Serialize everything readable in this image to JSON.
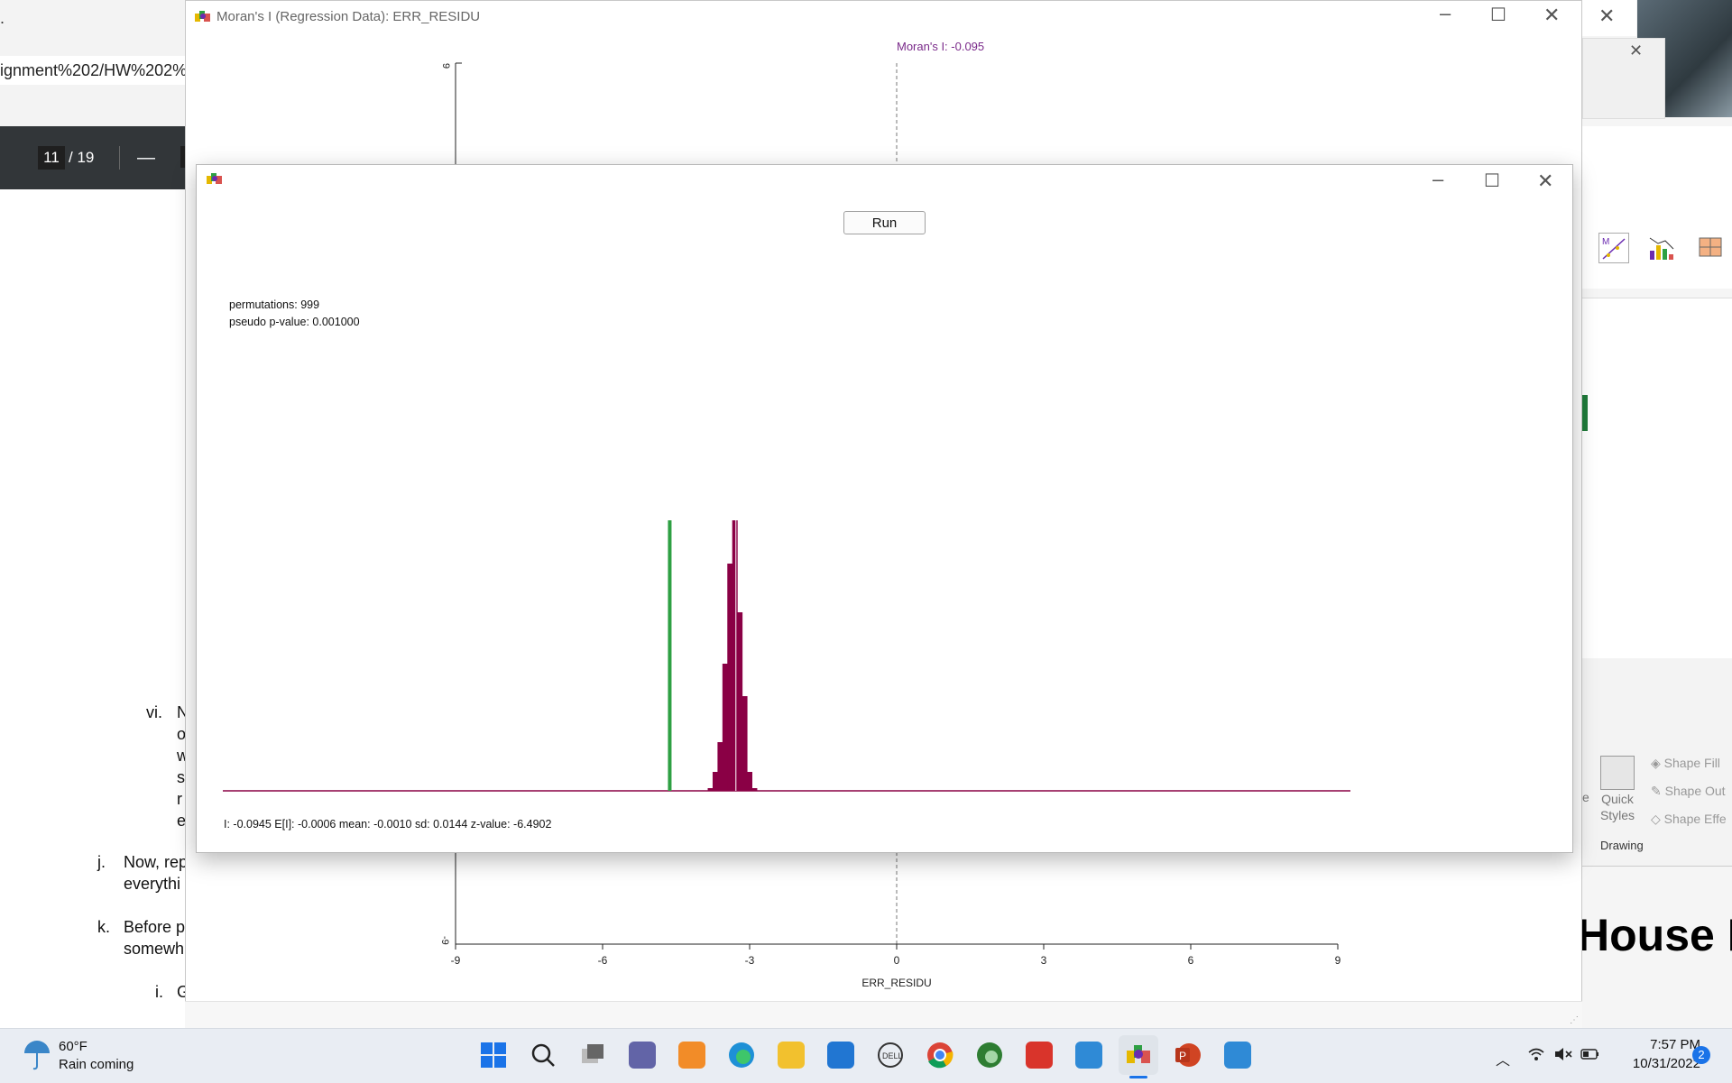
{
  "pdf": {
    "url_fragment": "ignment%202/HW%202%2",
    "page_current": "11",
    "page_total": "/ 19",
    "zoom_out": "—",
    "items": [
      {
        "marker": "vi.",
        "text": "N",
        "lines": [
          "o",
          "w",
          "s",
          "r",
          "e"
        ]
      },
      {
        "marker": "j.",
        "line1": "Now, rep",
        "line2": "everythi"
      },
      {
        "marker": "k.",
        "line1": "Before p",
        "line2": "somewh"
      },
      {
        "marker": "i.",
        "line1": "G"
      }
    ]
  },
  "main_window": {
    "title": "Moran's I (Regression Data): ERR_RESIDU",
    "moran_label": "Moran's I: -0.095",
    "x_axis_label": "ERR_RESIDU",
    "x_ticks": [
      "-9",
      "-6",
      "-3",
      "0",
      "3",
      "6",
      "9"
    ],
    "y_top": "9",
    "y_bottom": "-9"
  },
  "dialog": {
    "run_label": "Run",
    "permutations": "permutations: 999",
    "pvalue": "pseudo p-value: 0.001000",
    "stats": "I: -0.0945   E[I]: -0.0006   mean: -0.0010   sd: 0.0144    z-value: -6.4902"
  },
  "chart_data": {
    "type": "bar",
    "title": "",
    "observed_I": -0.0945,
    "observed_line_color": "#2ea043",
    "bar_color": "#8a0045",
    "bins": [
      {
        "pos": -3.8,
        "height": 0.01
      },
      {
        "pos": -3.7,
        "height": 0.07
      },
      {
        "pos": -3.6,
        "height": 0.18
      },
      {
        "pos": -3.5,
        "height": 0.47
      },
      {
        "pos": -3.4,
        "height": 0.84
      },
      {
        "pos": -3.3,
        "height": 1.0
      },
      {
        "pos": -3.2,
        "height": 0.66
      },
      {
        "pos": -3.1,
        "height": 0.35
      },
      {
        "pos": -3.0,
        "height": 0.07
      },
      {
        "pos": -2.9,
        "height": 0.01
      }
    ],
    "observed_pos": -4.63
  },
  "ppt": {
    "quick_styles": "Quick Styles",
    "shape_fill": "Shape Fill",
    "shape_outline": "Shape Out",
    "shape_effects": "Shape Effe",
    "drawing": "Drawing",
    "house_text": "House F"
  },
  "taskbar": {
    "weather_temp": "60°F",
    "weather_desc": "Rain coming",
    "time": "7:57 PM",
    "date": "10/31/2022",
    "notif_count": "2"
  }
}
